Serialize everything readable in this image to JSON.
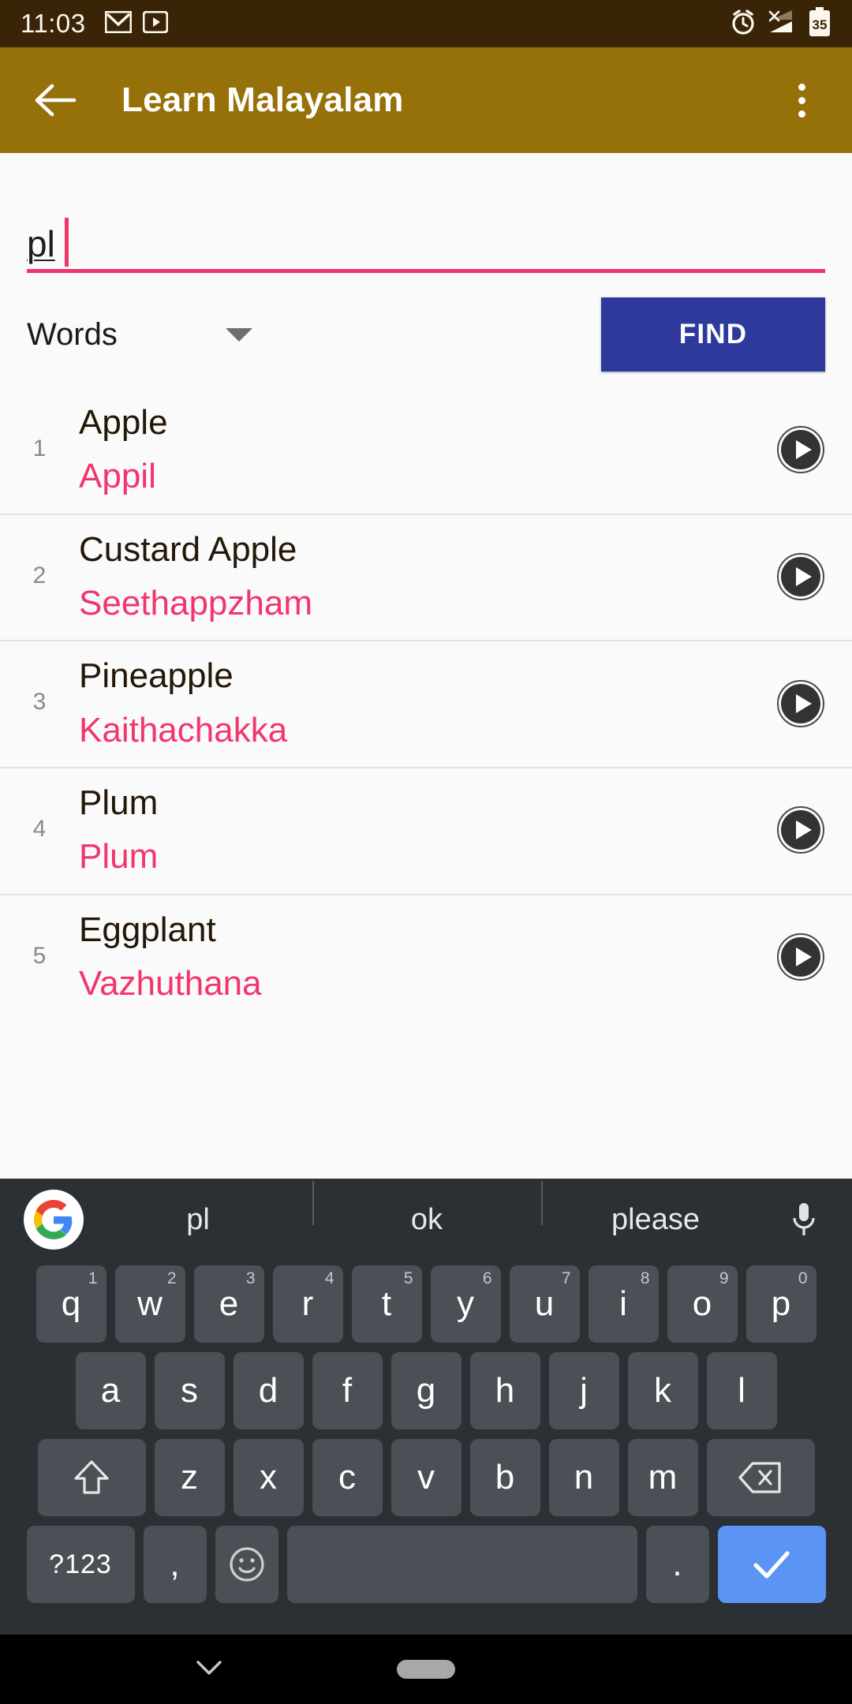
{
  "status_bar": {
    "time": "11:03",
    "left_icons": [
      "gmail-icon",
      "youtube-icon"
    ],
    "right_icons": [
      "alarm-icon",
      "signal-no-sim-icon",
      "battery-icon"
    ],
    "battery_level": "35",
    "background": "#3A2408"
  },
  "app_bar": {
    "title": "Learn Malayalam",
    "back_icon": "arrow-left-icon",
    "overflow_icon": "more-vertical-icon",
    "background": "#96710A"
  },
  "search": {
    "value": "pl",
    "placeholder": "",
    "accent": "#F0356B"
  },
  "filter": {
    "spinner_label": "Words",
    "spinner_icon": "chevron-down-icon",
    "find_label": "FIND",
    "find_color": "#2E3A9B"
  },
  "results": {
    "play_icon": "play-circle-icon",
    "translation_color": "#F3356E",
    "rows": [
      {
        "index": "1",
        "english": "Apple",
        "malayalam": "Appil"
      },
      {
        "index": "2",
        "english": "Custard Apple",
        "malayalam": "Seethappzham"
      },
      {
        "index": "3",
        "english": "Pineapple",
        "malayalam": "Kaithachakka"
      },
      {
        "index": "4",
        "english": "Plum",
        "malayalam": "Plum"
      },
      {
        "index": "5",
        "english": "Eggplant",
        "malayalam": "Vazhuthana"
      }
    ]
  },
  "keyboard": {
    "google_icon": "google-g-icon",
    "mic_icon": "microphone-icon",
    "suggestions": [
      "pl",
      "ok",
      "please"
    ],
    "row1": [
      {
        "label": "q",
        "num": "1"
      },
      {
        "label": "w",
        "num": "2"
      },
      {
        "label": "e",
        "num": "3"
      },
      {
        "label": "r",
        "num": "4"
      },
      {
        "label": "t",
        "num": "5"
      },
      {
        "label": "y",
        "num": "6"
      },
      {
        "label": "u",
        "num": "7"
      },
      {
        "label": "i",
        "num": "8"
      },
      {
        "label": "o",
        "num": "9"
      },
      {
        "label": "p",
        "num": "0"
      }
    ],
    "row2": [
      "a",
      "s",
      "d",
      "f",
      "g",
      "h",
      "j",
      "k",
      "l"
    ],
    "row3_letters": [
      "z",
      "x",
      "c",
      "v",
      "b",
      "n",
      "m"
    ],
    "shift_icon": "shift-up-arrow-icon",
    "backspace_icon": "backspace-icon",
    "symbols_label": "?123",
    "comma_label": ",",
    "emoji_icon": "emoji-smiley-icon",
    "space_label": "",
    "period_label": ".",
    "enter_icon": "check-icon",
    "enter_color": "#5C94F5",
    "background": "#2B3034",
    "key_color": "#4A5055"
  },
  "nav_bar": {
    "dismiss_icon": "chevron-down-icon",
    "home_pill": "home-gesture-pill"
  }
}
